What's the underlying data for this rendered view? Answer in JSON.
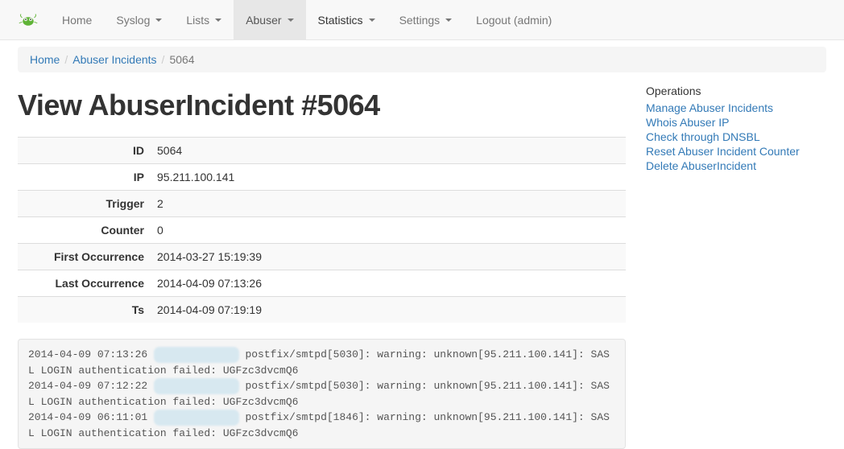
{
  "nav": {
    "home": "Home",
    "syslog": "Syslog",
    "lists": "Lists",
    "abuser": "Abuser",
    "statistics": "Statistics",
    "settings": "Settings",
    "logout": "Logout (admin)"
  },
  "breadcrumb": {
    "home": "Home",
    "abuser_incidents": "Abuser Incidents",
    "current": "5064"
  },
  "page_title": "View AbuserIncident #5064",
  "detail": {
    "labels": {
      "id": "ID",
      "ip": "IP",
      "trigger": "Trigger",
      "counter": "Counter",
      "first": "First Occurrence",
      "last": "Last Occurrence",
      "ts": "Ts"
    },
    "values": {
      "id": "5064",
      "ip": "95.211.100.141",
      "trigger": "2",
      "counter": "0",
      "first": "2014-03-27 15:19:39",
      "last": "2014-04-09 07:13:26",
      "ts": "2014-04-09 07:19:19"
    }
  },
  "log": {
    "entries": [
      {
        "ts": "2014-04-09 07:13:26",
        "host": "xx.x5.1x3.xx",
        "msg": "postfix/smtpd[5030]: warning: unknown[95.211.100.141]: SASL LOGIN authentication failed: UGFzc3dvcmQ6"
      },
      {
        "ts": "2014-04-09 07:12:22",
        "host": "xx.x5.1x3.xx",
        "msg": "postfix/smtpd[5030]: warning: unknown[95.211.100.141]: SASL LOGIN authentication failed: UGFzc3dvcmQ6"
      },
      {
        "ts": "2014-04-09 06:11:01",
        "host": "xx.x5.1x3.xx",
        "msg": "postfix/smtpd[1846]: warning: unknown[95.211.100.141]: SASL LOGIN authentication failed: UGFzc3dvcmQ6"
      }
    ]
  },
  "operations": {
    "title": "Operations",
    "items": [
      "Manage Abuser Incidents",
      "Whois Abuser IP",
      "Check through DNSBL",
      "Reset Abuser Incident Counter",
      "Delete AbuserIncident"
    ]
  }
}
